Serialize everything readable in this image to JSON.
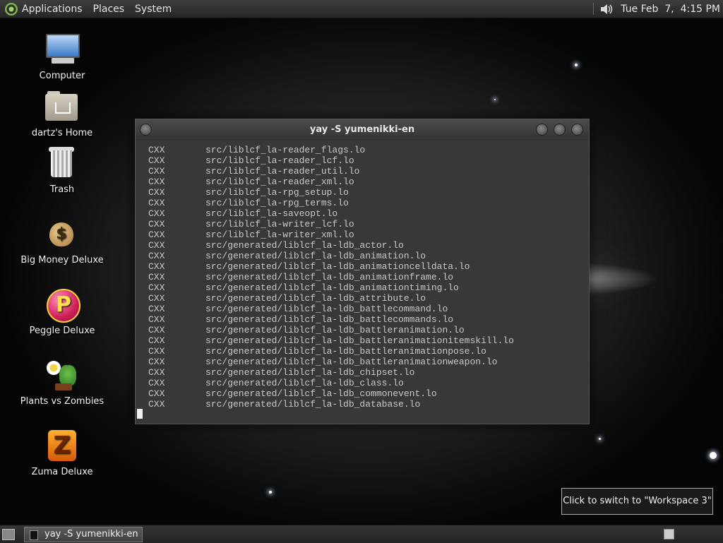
{
  "top_panel": {
    "menus": [
      "Applications",
      "Places",
      "System"
    ],
    "clock": "Tue Feb  7,  4:15 PM"
  },
  "desktop_icons": [
    {
      "label": "Computer"
    },
    {
      "label": "dartz's Home"
    },
    {
      "label": "Trash"
    },
    {
      "label": "Big Money Deluxe"
    },
    {
      "label": "Peggle Deluxe"
    },
    {
      "label": "Plants vs Zombies"
    },
    {
      "label": "Zuma Deluxe"
    }
  ],
  "terminal": {
    "title": "yay -S yumenikki-en",
    "lines": [
      {
        "tag": "CXX",
        "path": "src/liblcf_la-reader_flags.lo"
      },
      {
        "tag": "CXX",
        "path": "src/liblcf_la-reader_lcf.lo"
      },
      {
        "tag": "CXX",
        "path": "src/liblcf_la-reader_util.lo"
      },
      {
        "tag": "CXX",
        "path": "src/liblcf_la-reader_xml.lo"
      },
      {
        "tag": "CXX",
        "path": "src/liblcf_la-rpg_setup.lo"
      },
      {
        "tag": "CXX",
        "path": "src/liblcf_la-rpg_terms.lo"
      },
      {
        "tag": "CXX",
        "path": "src/liblcf_la-saveopt.lo"
      },
      {
        "tag": "CXX",
        "path": "src/liblcf_la-writer_lcf.lo"
      },
      {
        "tag": "CXX",
        "path": "src/liblcf_la-writer_xml.lo"
      },
      {
        "tag": "CXX",
        "path": "src/generated/liblcf_la-ldb_actor.lo"
      },
      {
        "tag": "CXX",
        "path": "src/generated/liblcf_la-ldb_animation.lo"
      },
      {
        "tag": "CXX",
        "path": "src/generated/liblcf_la-ldb_animationcelldata.lo"
      },
      {
        "tag": "CXX",
        "path": "src/generated/liblcf_la-ldb_animationframe.lo"
      },
      {
        "tag": "CXX",
        "path": "src/generated/liblcf_la-ldb_animationtiming.lo"
      },
      {
        "tag": "CXX",
        "path": "src/generated/liblcf_la-ldb_attribute.lo"
      },
      {
        "tag": "CXX",
        "path": "src/generated/liblcf_la-ldb_battlecommand.lo"
      },
      {
        "tag": "CXX",
        "path": "src/generated/liblcf_la-ldb_battlecommands.lo"
      },
      {
        "tag": "CXX",
        "path": "src/generated/liblcf_la-ldb_battleranimation.lo"
      },
      {
        "tag": "CXX",
        "path": "src/generated/liblcf_la-ldb_battleranimationitemskill.lo"
      },
      {
        "tag": "CXX",
        "path": "src/generated/liblcf_la-ldb_battleranimationpose.lo"
      },
      {
        "tag": "CXX",
        "path": "src/generated/liblcf_la-ldb_battleranimationweapon.lo"
      },
      {
        "tag": "CXX",
        "path": "src/generated/liblcf_la-ldb_chipset.lo"
      },
      {
        "tag": "CXX",
        "path": "src/generated/liblcf_la-ldb_class.lo"
      },
      {
        "tag": "CXX",
        "path": "src/generated/liblcf_la-ldb_commonevent.lo"
      },
      {
        "tag": "CXX",
        "path": "src/generated/liblcf_la-ldb_database.lo"
      }
    ]
  },
  "tooltip": {
    "text": "Click to switch to \"Workspace 3\""
  },
  "taskbar": {
    "task_label": "yay -S yumenikki-en"
  },
  "icons": {
    "panel_logo": "distro-logo",
    "volume": "speaker-icon",
    "show_desktop": "show-desktop-icon",
    "workspace": "workspace-switcher-icon"
  },
  "colors": {
    "panel_bg": "#2f2f2f",
    "terminal_bg": "#383837",
    "terminal_text": "#c8c8c8"
  }
}
